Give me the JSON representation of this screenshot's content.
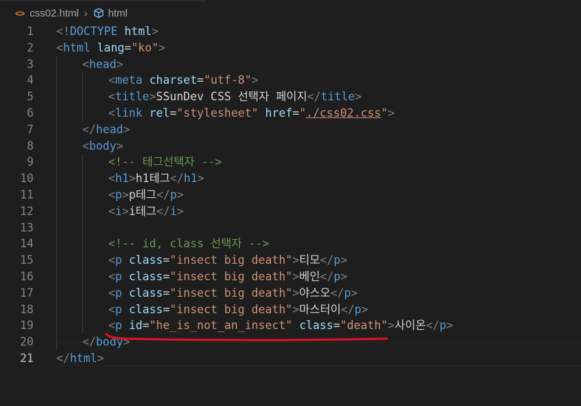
{
  "breadcrumb": {
    "file_icon": "<>",
    "file_name": "css02.html",
    "separator": "›",
    "symbol_icon": "cube-icon",
    "symbol_name": "html"
  },
  "colors": {
    "background": "#1e1e1e",
    "tag": "#569cd6",
    "attribute": "#9cdcfe",
    "value": "#ce9178",
    "comment": "#6a9955",
    "punctuation": "#808080",
    "text": "#d4d4d4",
    "annotation": "#e81123"
  },
  "editor": {
    "current_line": 21,
    "lines": [
      {
        "n": "1",
        "indent": 0,
        "tokens": [
          [
            "p",
            "<!"
          ],
          [
            "t",
            "DOCTYPE"
          ],
          [
            "x",
            " "
          ],
          [
            "a",
            "html"
          ],
          [
            "p",
            ">"
          ]
        ]
      },
      {
        "n": "2",
        "indent": 0,
        "tokens": [
          [
            "p",
            "<"
          ],
          [
            "t",
            "html"
          ],
          [
            "x",
            " "
          ],
          [
            "a",
            "lang"
          ],
          [
            "x",
            "="
          ],
          [
            "v",
            "\"ko\""
          ],
          [
            "p",
            ">"
          ]
        ]
      },
      {
        "n": "3",
        "indent": 1,
        "tokens": [
          [
            "p",
            "<"
          ],
          [
            "t",
            "head"
          ],
          [
            "p",
            ">"
          ]
        ]
      },
      {
        "n": "4",
        "indent": 2,
        "tokens": [
          [
            "p",
            "<"
          ],
          [
            "t",
            "meta"
          ],
          [
            "x",
            " "
          ],
          [
            "a",
            "charset"
          ],
          [
            "x",
            "="
          ],
          [
            "v",
            "\"utf-8\""
          ],
          [
            "p",
            ">"
          ]
        ]
      },
      {
        "n": "5",
        "indent": 2,
        "tokens": [
          [
            "p",
            "<"
          ],
          [
            "t",
            "title"
          ],
          [
            "p",
            ">"
          ],
          [
            "x",
            "SSunDev CSS 선택자 페이지"
          ],
          [
            "p",
            "</"
          ],
          [
            "t",
            "title"
          ],
          [
            "p",
            ">"
          ]
        ]
      },
      {
        "n": "6",
        "indent": 2,
        "tokens": [
          [
            "p",
            "<"
          ],
          [
            "t",
            "link"
          ],
          [
            "x",
            " "
          ],
          [
            "a",
            "rel"
          ],
          [
            "x",
            "="
          ],
          [
            "v",
            "\"stylesheet\""
          ],
          [
            "x",
            " "
          ],
          [
            "a",
            "href"
          ],
          [
            "x",
            "="
          ],
          [
            "v",
            "\""
          ],
          [
            "u",
            "./css02.css"
          ],
          [
            "v",
            "\""
          ],
          [
            "p",
            ">"
          ]
        ]
      },
      {
        "n": "7",
        "indent": 1,
        "tokens": [
          [
            "p",
            "</"
          ],
          [
            "t",
            "head"
          ],
          [
            "p",
            ">"
          ]
        ]
      },
      {
        "n": "8",
        "indent": 1,
        "tokens": [
          [
            "p",
            "<"
          ],
          [
            "t",
            "body"
          ],
          [
            "p",
            ">"
          ]
        ]
      },
      {
        "n": "9",
        "indent": 2,
        "tokens": [
          [
            "c",
            "<!-- 테그선택자 -->"
          ]
        ]
      },
      {
        "n": "10",
        "indent": 2,
        "tokens": [
          [
            "p",
            "<"
          ],
          [
            "t",
            "h1"
          ],
          [
            "p",
            ">"
          ],
          [
            "x",
            "h1테그"
          ],
          [
            "p",
            "</"
          ],
          [
            "t",
            "h1"
          ],
          [
            "p",
            ">"
          ]
        ]
      },
      {
        "n": "11",
        "indent": 2,
        "tokens": [
          [
            "p",
            "<"
          ],
          [
            "t",
            "p"
          ],
          [
            "p",
            ">"
          ],
          [
            "x",
            "p테그"
          ],
          [
            "p",
            "</"
          ],
          [
            "t",
            "p"
          ],
          [
            "p",
            ">"
          ]
        ]
      },
      {
        "n": "12",
        "indent": 2,
        "tokens": [
          [
            "p",
            "<"
          ],
          [
            "t",
            "i"
          ],
          [
            "p",
            ">"
          ],
          [
            "x",
            "i테그"
          ],
          [
            "p",
            "</"
          ],
          [
            "t",
            "i"
          ],
          [
            "p",
            ">"
          ]
        ]
      },
      {
        "n": "13",
        "indent": 2,
        "tokens": []
      },
      {
        "n": "14",
        "indent": 2,
        "tokens": [
          [
            "c",
            "<!-- id, class 선택자 -->"
          ]
        ]
      },
      {
        "n": "15",
        "indent": 2,
        "tokens": [
          [
            "p",
            "<"
          ],
          [
            "t",
            "p"
          ],
          [
            "x",
            " "
          ],
          [
            "a",
            "class"
          ],
          [
            "x",
            "="
          ],
          [
            "v",
            "\"insect big death\""
          ],
          [
            "p",
            ">"
          ],
          [
            "x",
            "티모"
          ],
          [
            "p",
            "</"
          ],
          [
            "t",
            "p"
          ],
          [
            "p",
            ">"
          ]
        ]
      },
      {
        "n": "16",
        "indent": 2,
        "tokens": [
          [
            "p",
            "<"
          ],
          [
            "t",
            "p"
          ],
          [
            "x",
            " "
          ],
          [
            "a",
            "class"
          ],
          [
            "x",
            "="
          ],
          [
            "v",
            "\"insect big death\""
          ],
          [
            "p",
            ">"
          ],
          [
            "x",
            "베인"
          ],
          [
            "p",
            "</"
          ],
          [
            "t",
            "p"
          ],
          [
            "p",
            ">"
          ]
        ]
      },
      {
        "n": "17",
        "indent": 2,
        "tokens": [
          [
            "p",
            "<"
          ],
          [
            "t",
            "p"
          ],
          [
            "x",
            " "
          ],
          [
            "a",
            "class"
          ],
          [
            "x",
            "="
          ],
          [
            "v",
            "\"insect big death\""
          ],
          [
            "p",
            ">"
          ],
          [
            "x",
            "야스오"
          ],
          [
            "p",
            "</"
          ],
          [
            "t",
            "p"
          ],
          [
            "p",
            ">"
          ]
        ]
      },
      {
        "n": "18",
        "indent": 2,
        "tokens": [
          [
            "p",
            "<"
          ],
          [
            "t",
            "p"
          ],
          [
            "x",
            " "
          ],
          [
            "a",
            "class"
          ],
          [
            "x",
            "="
          ],
          [
            "v",
            "\"insect big death\""
          ],
          [
            "p",
            ">"
          ],
          [
            "x",
            "마스터이"
          ],
          [
            "p",
            "</"
          ],
          [
            "t",
            "p"
          ],
          [
            "p",
            ">"
          ]
        ]
      },
      {
        "n": "19",
        "indent": 2,
        "tokens": [
          [
            "p",
            "<"
          ],
          [
            "t",
            "p"
          ],
          [
            "x",
            " "
          ],
          [
            "a",
            "id"
          ],
          [
            "x",
            "="
          ],
          [
            "v",
            "\"he_is_not_an_insect\""
          ],
          [
            "x",
            " "
          ],
          [
            "a",
            "class"
          ],
          [
            "x",
            "="
          ],
          [
            "v",
            "\"death\""
          ],
          [
            "p",
            ">"
          ],
          [
            "x",
            "사이온"
          ],
          [
            "p",
            "</"
          ],
          [
            "t",
            "p"
          ],
          [
            "p",
            ">"
          ]
        ]
      },
      {
        "n": "20",
        "indent": 1,
        "tokens": [
          [
            "p",
            "</"
          ],
          [
            "t",
            "body"
          ],
          [
            "p",
            ">"
          ]
        ]
      },
      {
        "n": "21",
        "indent": 0,
        "tokens": [
          [
            "p",
            "</"
          ],
          [
            "t",
            "html"
          ],
          [
            "p",
            ">"
          ]
        ]
      }
    ]
  }
}
